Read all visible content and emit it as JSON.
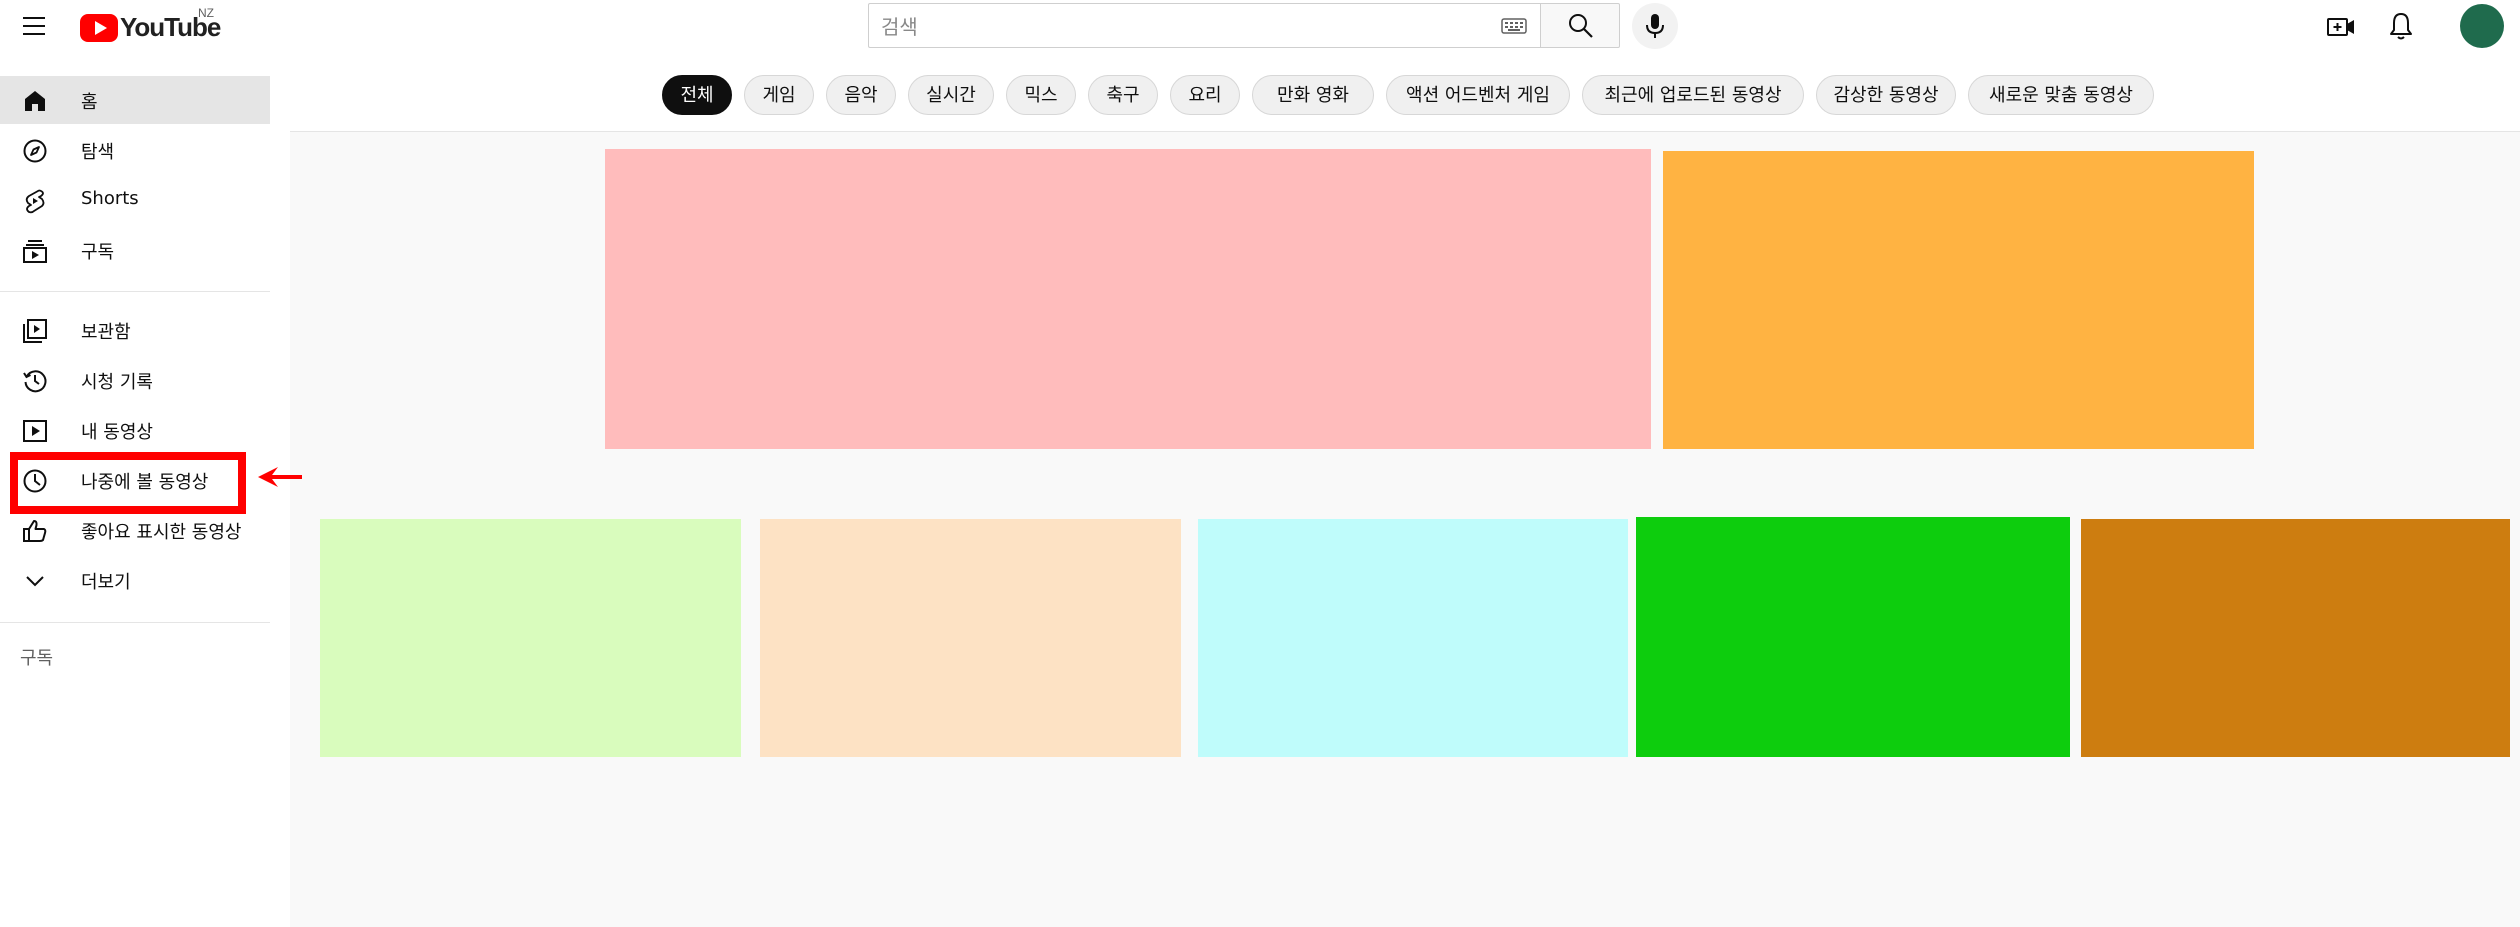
{
  "header": {
    "logo_text": "YouTube",
    "region": "NZ",
    "search_placeholder": "검색"
  },
  "sidebar": {
    "items": [
      {
        "label": "홈",
        "icon": "home-icon",
        "active": true
      },
      {
        "label": "탐색",
        "icon": "explore-icon"
      },
      {
        "label": "Shorts",
        "icon": "shorts-icon"
      },
      {
        "label": "구독",
        "icon": "subscriptions-icon"
      },
      {
        "label": "보관함",
        "icon": "library-icon"
      },
      {
        "label": "시청 기록",
        "icon": "history-icon"
      },
      {
        "label": "내 동영상",
        "icon": "your-videos-icon"
      },
      {
        "label": "나중에 볼 동영상",
        "icon": "watch-later-icon",
        "highlighted": true
      },
      {
        "label": "좋아요 표시한 동영상",
        "icon": "liked-videos-icon"
      },
      {
        "label": "더보기",
        "icon": "chevron-down-icon"
      }
    ],
    "subscriptions_heading": "구독"
  },
  "chips": [
    "전체",
    "게임",
    "음악",
    "실시간",
    "믹스",
    "축구",
    "요리",
    "만화 영화",
    "액션 어드벤처 게임",
    "최근에 업로드된 동영상",
    "감상한 동영상",
    "새로운 맞춤 동영상"
  ],
  "selected_chip": "전체",
  "tiles": [
    {
      "color": "#ffbcbc"
    },
    {
      "color": "#ffb342"
    },
    {
      "color": "#d9fcbd"
    },
    {
      "color": "#fde2c4"
    },
    {
      "color": "#bffcfb"
    },
    {
      "color": "#0dcd0d"
    },
    {
      "color": "#cd7d10"
    }
  ],
  "colors": {
    "brand_red": "#ff0000",
    "highlight": "#ff0000",
    "avatar": "#1f6b4d"
  }
}
